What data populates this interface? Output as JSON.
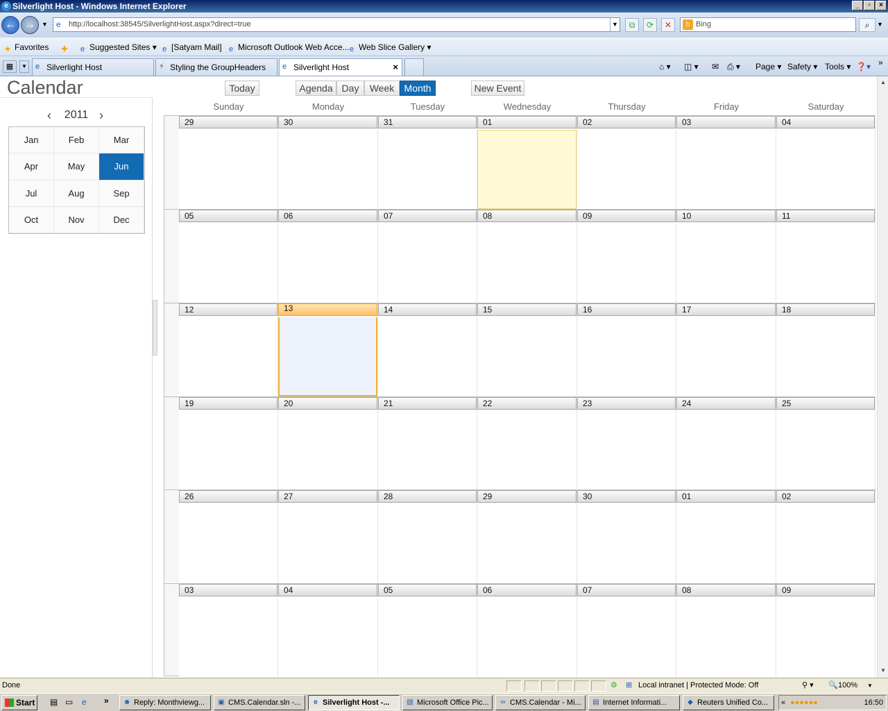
{
  "window": {
    "title": "Silverlight Host - Windows Internet Explorer"
  },
  "address": {
    "url": "http://localhost:38545/SilverlightHost.aspx?direct=true",
    "search_placeholder": "Bing"
  },
  "favorites": {
    "label": "Favorites",
    "items": [
      "Suggested Sites",
      "[Satyam Mail]",
      "Microsoft Outlook Web Acce...",
      "Web Slice Gallery"
    ]
  },
  "tabs": [
    {
      "label": "Silverlight Host"
    },
    {
      "label": "Styling the GroupHeaders"
    },
    {
      "label": "Silverlight Host"
    }
  ],
  "commandbar": {
    "page": "Page",
    "safety": "Safety",
    "tools": "Tools"
  },
  "app": {
    "title": "Calendar",
    "today_label": "Today",
    "views": [
      "Agenda",
      "Day",
      "Week",
      "Month"
    ],
    "selected_view": "Month",
    "new_event_label": "New Event",
    "year": "2011",
    "months": [
      "Jan",
      "Feb",
      "Mar",
      "Apr",
      "May",
      "Jun",
      "Jul",
      "Aug",
      "Sep",
      "Oct",
      "Nov",
      "Dec"
    ],
    "selected_month": "Jun",
    "day_names": [
      "Sunday",
      "Monday",
      "Tuesday",
      "Wednesday",
      "Thursday",
      "Friday",
      "Saturday"
    ],
    "weeks": [
      [
        "29",
        "30",
        "31",
        "01",
        "02",
        "03",
        "04"
      ],
      [
        "05",
        "06",
        "07",
        "08",
        "09",
        "10",
        "11"
      ],
      [
        "12",
        "13",
        "14",
        "15",
        "16",
        "17",
        "18"
      ],
      [
        "19",
        "20",
        "21",
        "22",
        "23",
        "24",
        "25"
      ],
      [
        "26",
        "27",
        "28",
        "29",
        "30",
        "01",
        "02"
      ],
      [
        "03",
        "04",
        "05",
        "06",
        "07",
        "08",
        "09"
      ]
    ],
    "today_cell": [
      0,
      3
    ],
    "selected_cell": [
      2,
      1
    ]
  },
  "status": {
    "text": "Done",
    "zone": "Local intranet | Protected Mode: Off",
    "zoom": "100%"
  },
  "taskbar": {
    "start": "Start",
    "tasks": [
      "Reply: Monthviewg...",
      "CMS.Calendar.sln -...",
      "Silverlight Host -...",
      "Microsoft Office Pic...",
      "CMS.Calendar - Mi...",
      "Internet Informati...",
      "Reuters Unified Co..."
    ],
    "active_task": 2,
    "clock": "16:50"
  }
}
